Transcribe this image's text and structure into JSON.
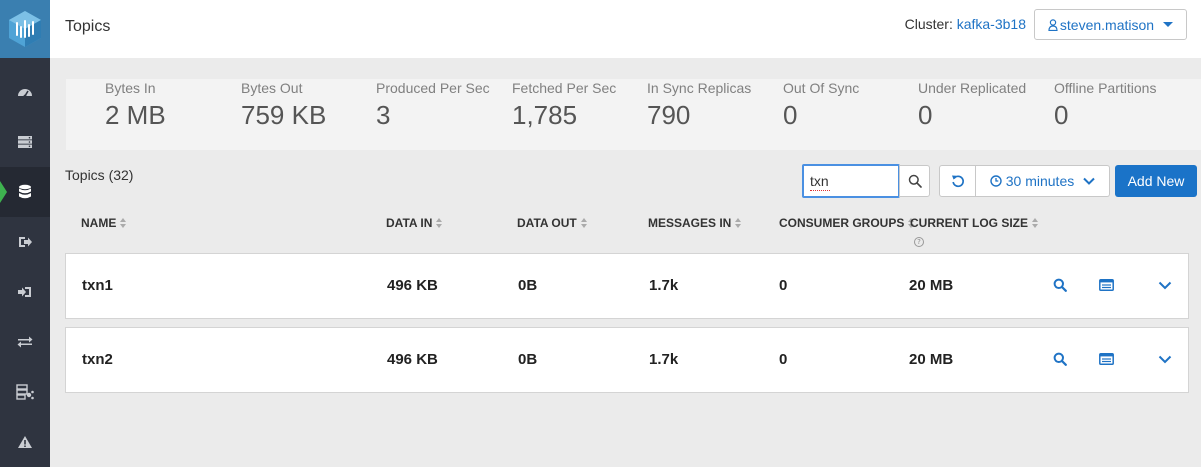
{
  "header": {
    "title": "Topics",
    "cluster_label": "Cluster:",
    "cluster_name": "kafka-3b18",
    "user": "steven.matison"
  },
  "sidebar": {
    "items": [
      {
        "icon": "dashboard-icon"
      },
      {
        "icon": "brokers-icon"
      },
      {
        "icon": "topics-icon",
        "active": true
      },
      {
        "icon": "producers-icon"
      },
      {
        "icon": "consumers-icon"
      },
      {
        "icon": "replication-icon"
      },
      {
        "icon": "data-explorer-icon"
      },
      {
        "icon": "alerts-icon"
      }
    ]
  },
  "metrics": [
    {
      "label": "Bytes In",
      "value": "2 MB"
    },
    {
      "label": "Bytes Out",
      "value": "759 KB"
    },
    {
      "label": "Produced Per Sec",
      "value": "3"
    },
    {
      "label": "Fetched Per Sec",
      "value": "1,785"
    },
    {
      "label": "In Sync Replicas",
      "value": "790"
    },
    {
      "label": "Out Of Sync",
      "value": "0"
    },
    {
      "label": "Under Replicated",
      "value": "0"
    },
    {
      "label": "Offline Partitions",
      "value": "0"
    }
  ],
  "toolbar": {
    "topics_count": "Topics (32)",
    "search_value": "txn",
    "time_range": "30 minutes",
    "add_label": "Add New"
  },
  "table": {
    "columns": [
      "NAME",
      "DATA IN",
      "DATA OUT",
      "MESSAGES IN",
      "CONSUMER GROUPS",
      "CURRENT LOG SIZE"
    ],
    "help_glyph": "?",
    "rows": [
      {
        "name": "txn1",
        "data_in": "496 KB",
        "data_out": "0B",
        "messages_in": "1.7k",
        "consumer_groups": "0",
        "log_size": "20 MB"
      },
      {
        "name": "txn2",
        "data_in": "496 KB",
        "data_out": "0B",
        "messages_in": "1.7k",
        "consumer_groups": "0",
        "log_size": "20 MB"
      }
    ]
  },
  "colors": {
    "accent": "#1f73c5",
    "sidebar": "#2f3440",
    "active_marker": "#3eb24f",
    "primary_button": "#1a73c8"
  }
}
